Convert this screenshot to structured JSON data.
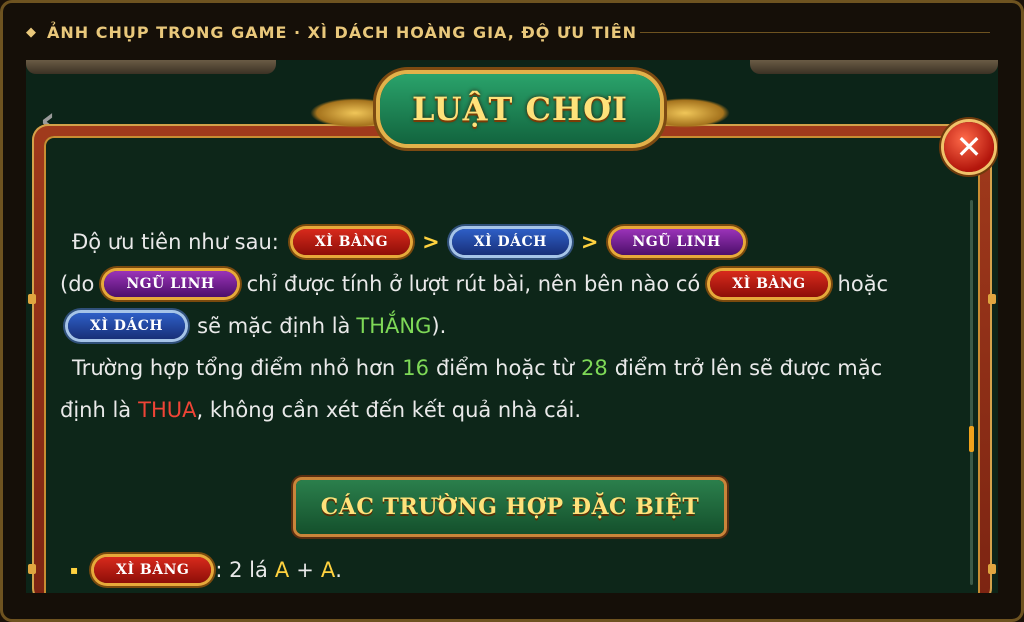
{
  "caption": {
    "diamond_icon": "◆",
    "text": "ẢNH CHỤP TRONG GAME · XÌ DÁCH HOÀNG GIA, ĐỘ ƯU TIÊN"
  },
  "panel": {
    "title": "LUẬT CHƠI",
    "close_glyph": "✕",
    "back_glyph": "‹"
  },
  "badges": {
    "xi_bang": "XÌ BÀNG",
    "xi_dach": "XÌ DÁCH",
    "ngu_linh": "NGŨ LINH"
  },
  "rules": {
    "line1_prefix": "Độ ưu tiên như sau:",
    "gt": ">",
    "line2_open": "(do",
    "line2_mid": "chỉ được tính ở lượt rút bài, nên bên nào có",
    "line2_end": "hoặc",
    "line3_mid": "sẽ mặc định là",
    "line3_win": "THẮNG",
    "line3_close": ").",
    "line4_a": "Trường hợp tổng điểm nhỏ hơn",
    "line4_num1": "16",
    "line4_b": "điểm hoặc từ",
    "line4_num2": "28",
    "line4_c": "điểm trở lên sẽ được mặc",
    "line5_a": "định là",
    "line5_lose": "THUA",
    "line5_b": ", không cần xét đến kết quả nhà cái."
  },
  "special_section": {
    "label": "CÁC TRƯỜNG HỢP ĐẶC BIỆT"
  },
  "special_items": [
    {
      "bullet": "▪",
      "colon": ": 2 lá",
      "card1": "A",
      "plus": "+",
      "card2": "A",
      "end": "."
    }
  ],
  "colors": {
    "win": "#7ed957",
    "lose": "#ef4436",
    "highlight": "#ffd23f",
    "title_gold": "#ffe27a"
  }
}
